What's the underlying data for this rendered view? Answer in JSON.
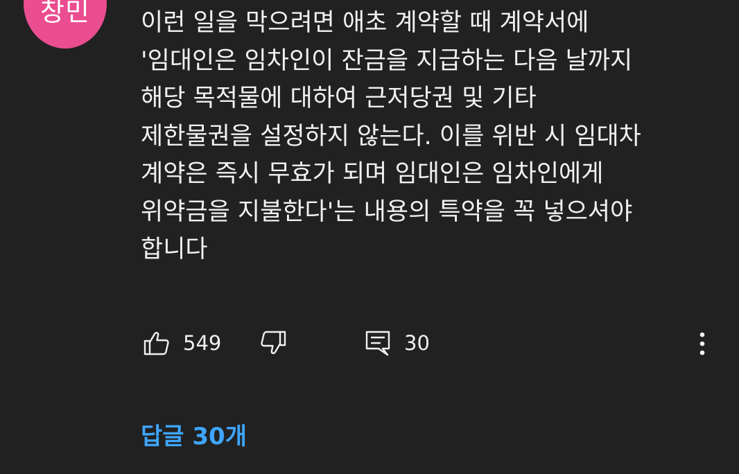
{
  "author": {
    "avatar_text": "창민",
    "avatar_color": "#ea4d90"
  },
  "comment": {
    "lines": [
      "이런 일을 막으려면 애초 계약할 때 계약서에",
      "'임대인은 임차인이 잔금을 지급하는 다음 날까지",
      "해당 목적물에 대하여 근저당권 및 기타",
      "제한물권을 설정하지 않는다. 이를 위반 시 임대차",
      "계약은 즉시 무효가 되며 임대인은 임차인에게",
      "위약금을 지불한다'는 내용의 특약을 꼭 넣으셔야",
      "합니다"
    ]
  },
  "actions": {
    "like_count": "549",
    "reply_count": "30",
    "like_icon": "thumbs-up-icon",
    "dislike_icon": "thumbs-down-icon",
    "reply_icon": "comment-icon",
    "more_icon": "more-vertical-icon"
  },
  "replies": {
    "label": "답글 30개",
    "color": "#3ea6ff"
  }
}
